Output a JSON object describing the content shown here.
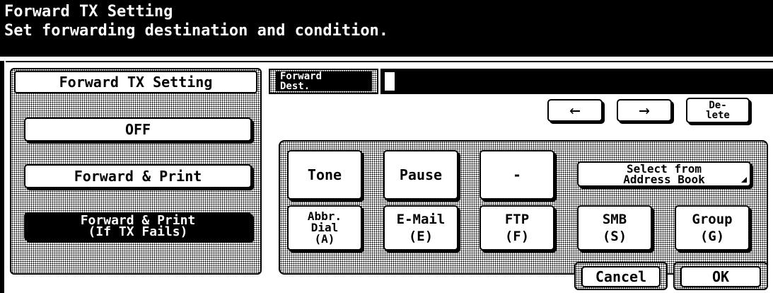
{
  "header": {
    "title": "Forward TX Setting",
    "subtitle": "Set forwarding destination and condition."
  },
  "left_panel": {
    "title": "Forward TX Setting",
    "options": [
      {
        "label": "OFF",
        "selected": false
      },
      {
        "label": "Forward & Print",
        "selected": false
      },
      {
        "label": "Forward & Print\n(If TX Fails)",
        "selected": true
      }
    ]
  },
  "dest": {
    "label": "Forward\nDest.",
    "value": ""
  },
  "edit_buttons": {
    "left_arrow": "←",
    "right_arrow": "→",
    "delete": "De-\nlete"
  },
  "keypad": {
    "row1": [
      "Tone",
      "Pause",
      "-"
    ],
    "address_book": "Select from\nAddress Book",
    "row2": [
      {
        "name": "abbr-dial",
        "label": "Abbr.\nDial\n(A)"
      },
      {
        "name": "email",
        "label": "E-Mail\n(E)"
      },
      {
        "name": "ftp",
        "label": "FTP\n(F)"
      },
      {
        "name": "smb",
        "label": "SMB\n(S)"
      },
      {
        "name": "group",
        "label": "Group\n(G)"
      }
    ]
  },
  "footer": {
    "cancel": "Cancel",
    "ok": "OK"
  }
}
